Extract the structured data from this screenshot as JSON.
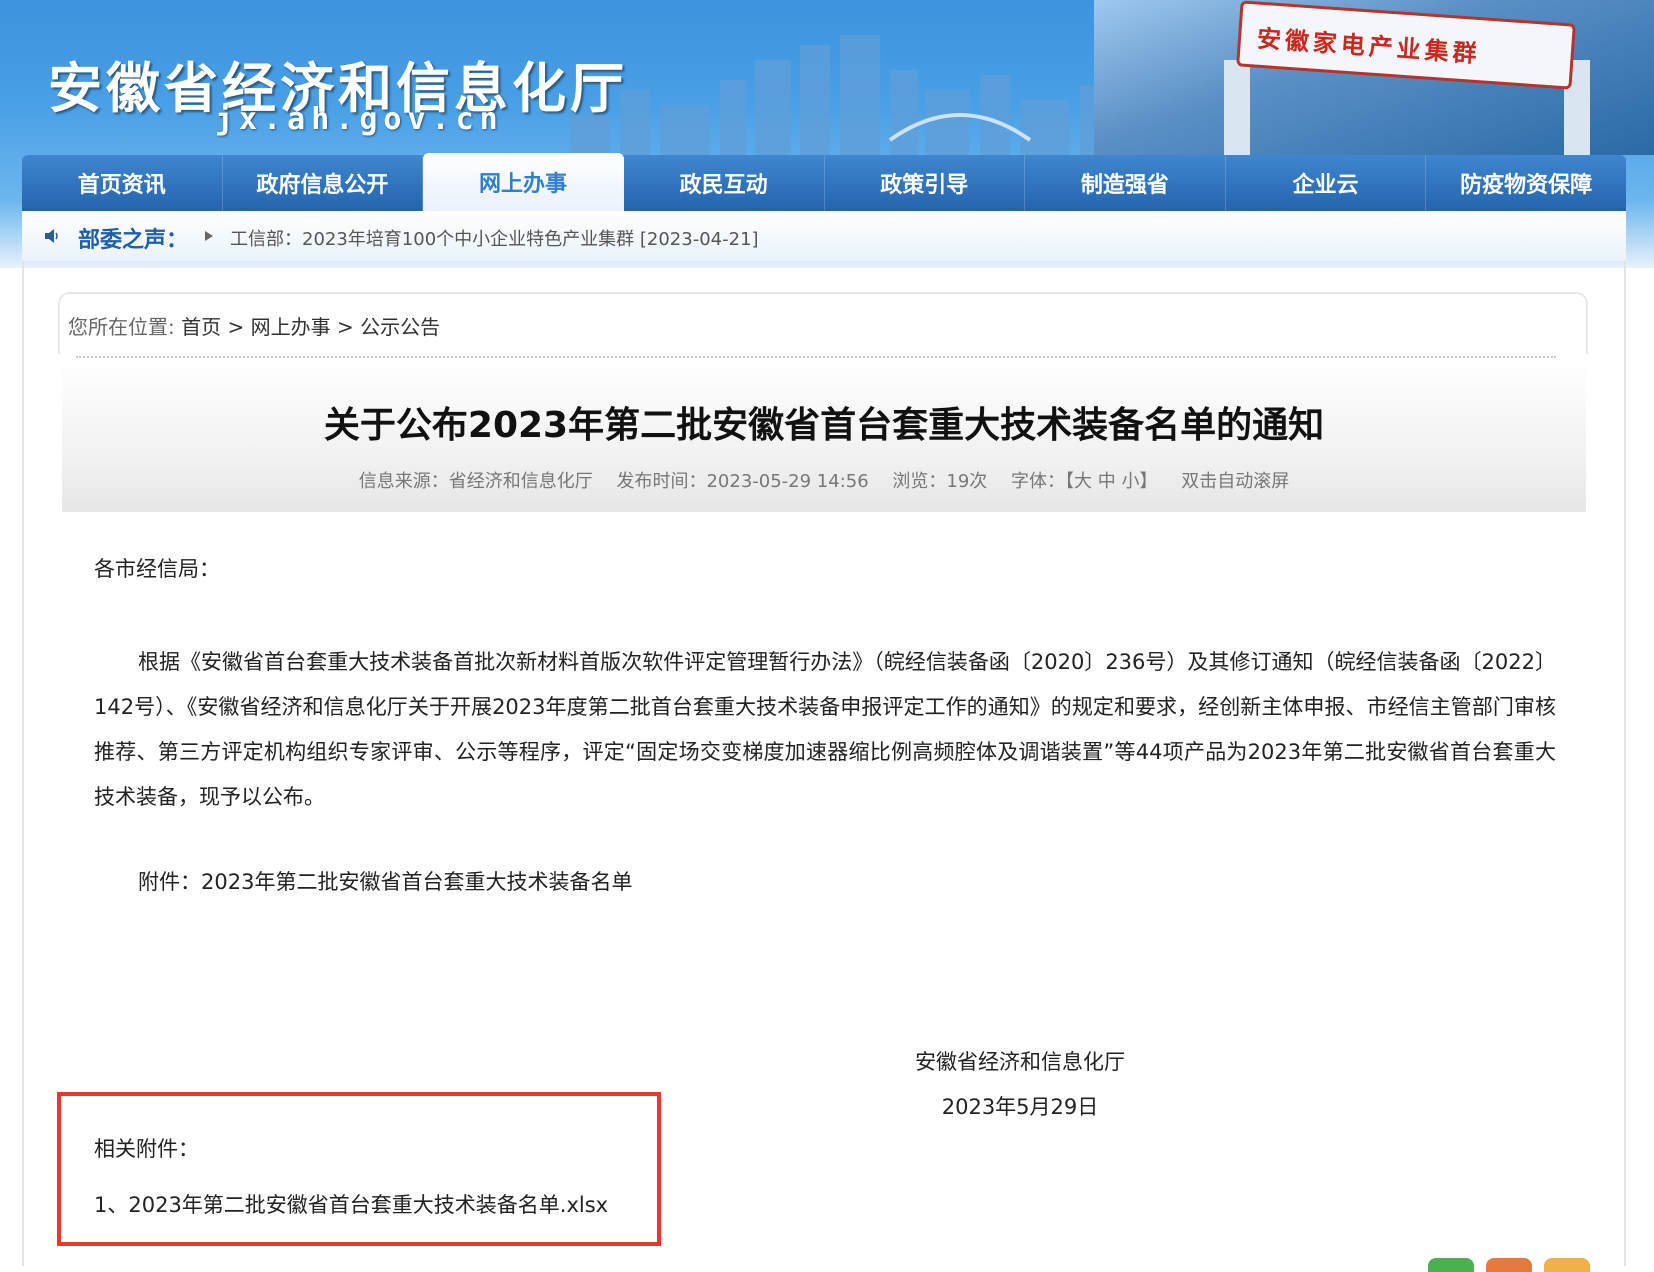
{
  "header": {
    "site_title": "安徽省经济和信息化厅",
    "site_domain": "jx.ah.gov.cn",
    "banner_sign": "安徽家电产业集群"
  },
  "nav": {
    "items": [
      {
        "label": "首页资讯"
      },
      {
        "label": "政府信息公开"
      },
      {
        "label": "网上办事",
        "active": true
      },
      {
        "label": "政民互动"
      },
      {
        "label": "政策引导"
      },
      {
        "label": "制造强省"
      },
      {
        "label": "企业云"
      },
      {
        "label": "防疫物资保障"
      }
    ]
  },
  "ticker": {
    "label": "部委之声：",
    "text": "工信部：2023年培育100个中小企业特色产业集群 [2023-04-21]"
  },
  "breadcrumb": {
    "prefix": "您所在位置:",
    "items": [
      "首页",
      "网上办事",
      "公示公告"
    ],
    "separator": ">"
  },
  "article": {
    "title": "关于公布2023年第二批安徽省首台套重大技术装备名单的通知",
    "meta": {
      "source": "信息来源：省经济和信息化厅",
      "published": "发布时间：2023-05-29 14:56",
      "views": "浏览：19次",
      "font_label": "字体：",
      "font_open": "【",
      "font_large": "大",
      "font_medium": "中",
      "font_small": "小",
      "font_close": "】",
      "autoscroll": "双击自动滚屏"
    },
    "salutation": "各市经信局：",
    "paragraph": "根据《安徽省首台套重大技术装备首批次新材料首版次软件评定管理暂行办法》（皖经信装备函〔2020〕236号）及其修订通知（皖经信装备函〔2022〕142号）、《安徽省经济和信息化厅关于开展2023年度第二批首台套重大技术装备申报评定工作的通知》的规定和要求，经创新主体申报、市经信主管部门审核推荐、第三方评定机构组织专家评审、公示等程序，评定“固定场交变梯度加速器缩比例高频腔体及调谐装置”等44项产品为2023年第二批安徽省首台套重大技术装备，现予以公布。",
    "attachment_note": "附件：2023年第二批安徽省首台套重大技术装备名单",
    "sign_org": "安徽省经济和信息化厅",
    "sign_date": "2023年5月29日"
  },
  "attachments": {
    "heading": "相关附件：",
    "files": [
      "1、2023年第二批安徽省首台套重大技术装备名单.xlsx"
    ]
  },
  "colors": {
    "nav_bg": "#2464ad",
    "nav_active_text": "#2d7fd0",
    "ticker_label": "#1f5fa8",
    "highlight_border": "#e03c2b"
  }
}
